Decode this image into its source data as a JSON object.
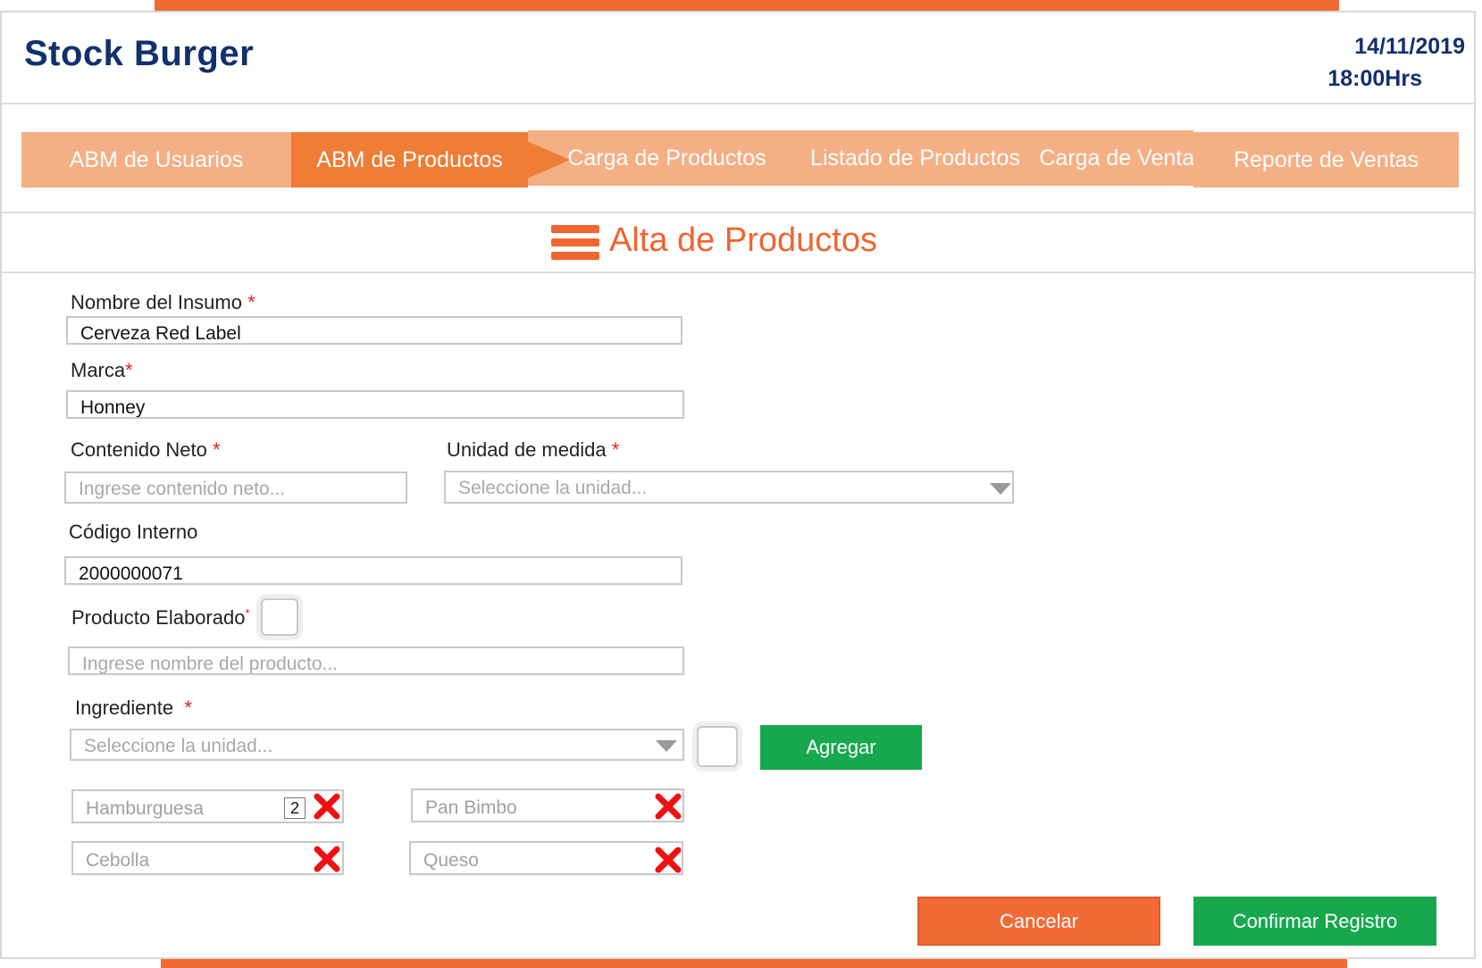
{
  "header": {
    "app_title": "Stock Burger",
    "date": "14/11/2019",
    "time": "18:00Hrs"
  },
  "nav": {
    "tabs": [
      {
        "label": "ABM de Usuarios",
        "active": false
      },
      {
        "label": "ABM de Productos",
        "active": true
      },
      {
        "label": "Carga de Productos",
        "active": false
      },
      {
        "label": "Listado de Productos",
        "active": false
      },
      {
        "label": "Carga de Ventas",
        "active": false
      },
      {
        "label": "Reporte de Ventas",
        "active": false
      }
    ]
  },
  "section": {
    "icon": "menu-icon",
    "title": "Alta de Productos"
  },
  "form": {
    "required_mark": "*",
    "nombre": {
      "label": "Nombre del Insumo",
      "value": "Cerveza Red Label"
    },
    "marca": {
      "label": "Marca",
      "value": "Honney"
    },
    "contenido": {
      "label": "Contenido Neto",
      "placeholder": "Ingrese contenido neto..."
    },
    "unidad": {
      "label": "Unidad de medida",
      "placeholder": "Seleccione la unidad..."
    },
    "codigo": {
      "label": "Código Interno",
      "value": "2000000071"
    },
    "elaborado": {
      "label": "Producto Elaborado",
      "checked": false,
      "placeholder": "Ingrese nombre del producto..."
    },
    "ingrediente": {
      "label": "Ingrediente",
      "placeholder": "Seleccione la unidad...",
      "add_label": "Agregar"
    }
  },
  "ingredients": [
    {
      "name": "Hamburguesa",
      "qty": "2"
    },
    {
      "name": "Pan Bimbo"
    },
    {
      "name": "Cebolla"
    },
    {
      "name": "Queso"
    }
  ],
  "actions": {
    "cancel": "Cancelar",
    "confirm": "Confirmar Registro"
  },
  "colors": {
    "brand_navy": "#12306e",
    "accent_orange": "#f26a35",
    "tab_light": "#f4af85",
    "tab_active": "#ef7d35",
    "success_green": "#17a84d",
    "required_red": "#e02020"
  }
}
